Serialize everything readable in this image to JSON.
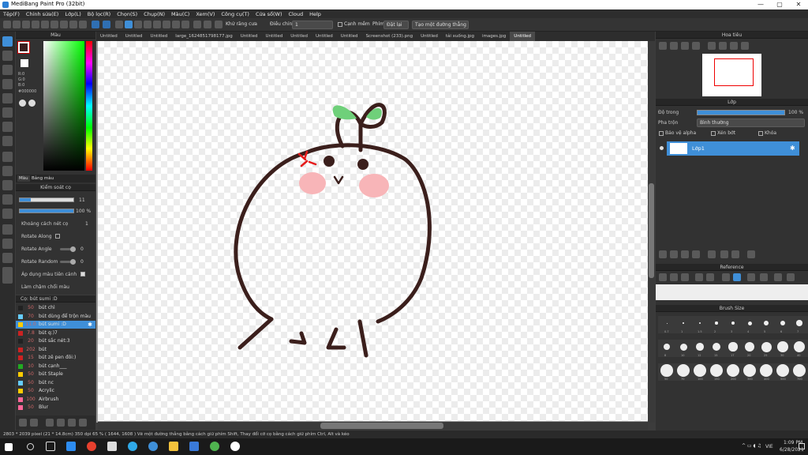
{
  "title": "MediBang Paint Pro (32bit)",
  "window_controls": [
    "—",
    "▢",
    "✕"
  ],
  "menu": [
    "Tệp(F)",
    "Chỉnh sửa(E)",
    "Lớp(L)",
    "Bộ lọc(R)",
    "Chọn(S)",
    "Chụp(N)",
    "Màu(C)",
    "Xem(V)",
    "Công cụ(T)",
    "Cửa sổ(W)",
    "Cloud",
    "Help"
  ],
  "toolbar": {
    "antialias_label": "Khử răng cưa",
    "correction_label": "Điều chỉnh",
    "correction_value": "1",
    "snap_label": "Cạnh mềm",
    "snap_prefix": "Phím",
    "snap_off": "Đặt lại",
    "ruler_label": "Tạo một đường thẳng"
  },
  "tabs": [
    "Untitled",
    "Untitled",
    "Untitled",
    "large_1624851798177.jpg",
    "Untitled",
    "Untitled",
    "Untitled",
    "Untitled",
    "Untitled",
    "Screenshot (233).png",
    "Untitled",
    "tải xuống.jpg",
    "images.jpg",
    "Untitled"
  ],
  "active_tab_index": 13,
  "color_panel": {
    "title": "Màu",
    "tabs": [
      "Màu",
      "Bảng màu"
    ],
    "r": "R:0",
    "g": "G:0",
    "b": "B:0",
    "hex": "#000000",
    "fg_color": "#3a1e1e",
    "bg_color": "#ffffff"
  },
  "brush_control": {
    "title": "Kiểm soát cọ",
    "size_value": "11",
    "opacity_value": "100 %",
    "opacity_fraction": 1.0,
    "size_fraction": 0.2,
    "props": [
      "Khoảng cách nét cọ",
      "Rotate Along",
      "Rotate Angle",
      "Rotate Random",
      "Áp dụng màu tiên cảnh",
      "Làm chậm chổi màu"
    ],
    "prop_values": [
      "1",
      "",
      "0",
      "0",
      "",
      ""
    ]
  },
  "brush_list": {
    "title": "Cọ: bút sumi :D",
    "items": [
      {
        "size": "50",
        "name": "bút chì",
        "color": "#222222"
      },
      {
        "size": "70",
        "name": "bút dùng để trộn màu",
        "color": "#66ccff"
      },
      {
        "size": "11.0",
        "name": "bút sumi :D",
        "color": "#ffcc00"
      },
      {
        "size": "7.8",
        "name": "bút q:)7",
        "color": "#cc2222"
      },
      {
        "size": "20",
        "name": "bút sắc nét:3",
        "color": "#222222"
      },
      {
        "size": "202",
        "name": "bút",
        "color": "#cc2222"
      },
      {
        "size": "15",
        "name": "bút zê pen đôi:)",
        "color": "#cc2222"
      },
      {
        "size": "10",
        "name": "bút cạnh___",
        "color": "#22aa22"
      },
      {
        "size": "50",
        "name": "bút Staple",
        "color": "#ffcc00"
      },
      {
        "size": "50",
        "name": "bút nc",
        "color": "#66ccff"
      },
      {
        "size": "50",
        "name": "Acrylic",
        "color": "#ffcc00"
      },
      {
        "size": "100",
        "name": "Airbrush",
        "color": "#ff6699"
      },
      {
        "size": "50",
        "name": "Blur",
        "color": "#ff6699"
      }
    ],
    "selected_index": 2
  },
  "navigator": {
    "title": "Hoa tiêu"
  },
  "layer_panel": {
    "title": "Lớp",
    "opacity_label": "Độ trong",
    "opacity_value": "100 %",
    "opacity_fraction": 1.0,
    "blend_label": "Pha trộn",
    "blend_value": "Bình thường",
    "protect_alpha": "Bảo vệ alpha",
    "clipping": "Xén bớt",
    "lock": "Khóa",
    "layers": [
      {
        "name": "Lớp1"
      }
    ]
  },
  "reference_panel": {
    "title": "Reference"
  },
  "brush_size_panel": {
    "title": "Brush Size",
    "sizes": [
      "0.7",
      "1",
      "1.5",
      "2",
      "3",
      "4",
      "5",
      "6",
      "7",
      "8",
      "10",
      "12",
      "15",
      "17",
      "20",
      "25",
      "30",
      "40",
      "50",
      "70",
      "100",
      "150",
      "200",
      "300",
      "400",
      "500",
      "700"
    ]
  },
  "status": "2803 * 2039 pixel   (21 * 14.8cm)   350 dpi   65 %   ( 1644, 1608 )   Vẽ một đường thẳng bằng cách giữ phím Shift, Thay đổi cỡ cọ bằng cách giữ phím Ctrl, Alt và kéo",
  "taskbar": {
    "time": "1:09 PM",
    "date": "6/28/2021",
    "lang": "VIE"
  }
}
